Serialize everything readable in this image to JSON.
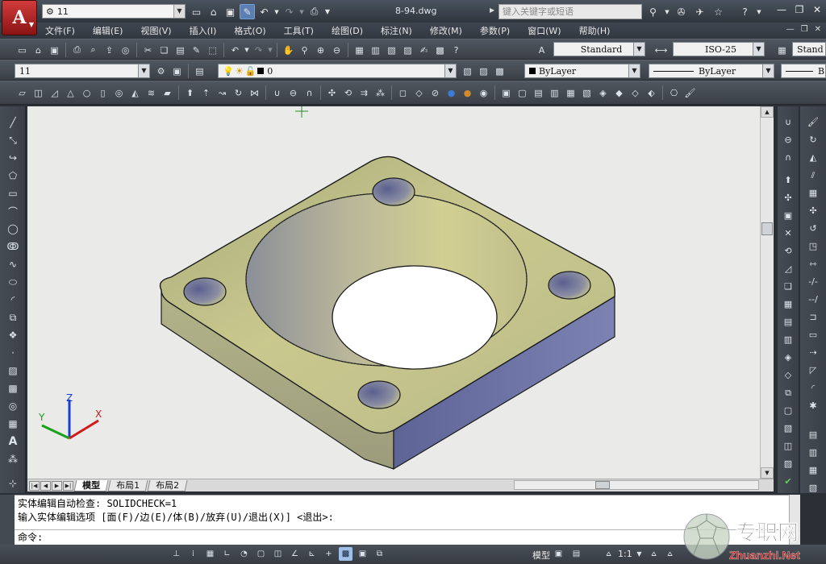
{
  "title_bar": {
    "app_letter": "A",
    "workspace": "11",
    "document_title": "8-94.dwg",
    "search_placeholder": "键入关键字或短语"
  },
  "menu": [
    "文件(F)",
    "编辑(E)",
    "视图(V)",
    "插入(I)",
    "格式(O)",
    "工具(T)",
    "绘图(D)",
    "标注(N)",
    "修改(M)",
    "参数(P)",
    "窗口(W)",
    "帮助(H)"
  ],
  "toolbars": {
    "text_style": "Standard",
    "dim_style": "ISO-25",
    "table_style": "Stand",
    "layer_state": "11",
    "current_layer": "0",
    "color": "ByLayer",
    "linetype": "ByLayer",
    "lineweight": "B"
  },
  "tabs": [
    "模型",
    "布局1",
    "布局2"
  ],
  "command_line": {
    "history": [
      "实体编辑自动检查:  SOLIDCHECK=1",
      "输入实体编辑选项 [面(F)/边(E)/体(B)/放弃(U)/退出(X)] <退出>:"
    ],
    "prompt": "命令:"
  },
  "status_bar": {
    "model_label": "模型",
    "scale": "1:1"
  },
  "watermark": {
    "text": "专职网",
    "url": "Zhuanzhi.Net"
  },
  "ucs_labels": {
    "x": "X",
    "y": "Y",
    "z": "Z"
  },
  "colors": {
    "solid_top": "#c4c48a",
    "solid_side": "#6a73a6",
    "canvas_bg": "#eaeae8"
  }
}
